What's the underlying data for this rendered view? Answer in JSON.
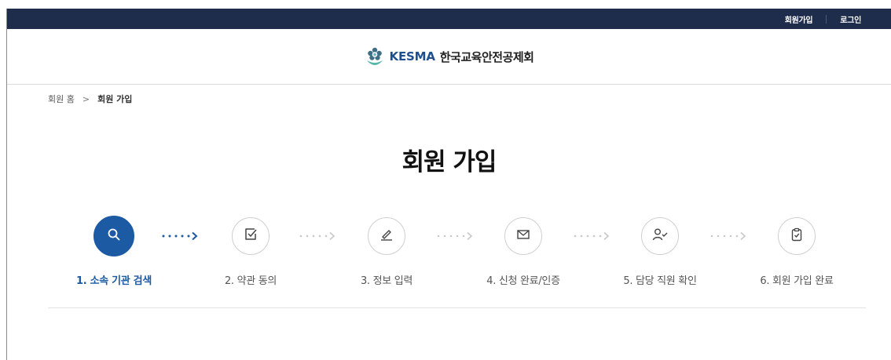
{
  "topbar": {
    "signup_label": "회원가입",
    "login_label": "로그인"
  },
  "brand": {
    "name_en": "KESMA",
    "name_ko": "한국교육안전공제회",
    "logo_icon": "kesma-flower-hand-icon"
  },
  "breadcrumb": {
    "home": "회원 홈",
    "separator": ">",
    "current": "회원 가입"
  },
  "page": {
    "title": "회원 가입"
  },
  "steps": [
    {
      "label": "1. 소속 기관 검색",
      "icon": "search-icon",
      "active": true
    },
    {
      "label": "2. 약관 동의",
      "icon": "checkbox-icon",
      "active": false
    },
    {
      "label": "3. 정보 입력",
      "icon": "pencil-icon",
      "active": false
    },
    {
      "label": "4. 신청 완료/인증",
      "icon": "mail-icon",
      "active": false
    },
    {
      "label": "5. 담당 직원 확인",
      "icon": "user-check-icon",
      "active": false
    },
    {
      "label": "6. 회원 가입 완료",
      "icon": "clipboard-check-icon",
      "active": false
    }
  ],
  "colors": {
    "topbar_bg": "#1f2d4d",
    "accent": "#1c5aa3",
    "inactive_text": "#555555",
    "inactive_arrow": "#c8c8c8"
  }
}
